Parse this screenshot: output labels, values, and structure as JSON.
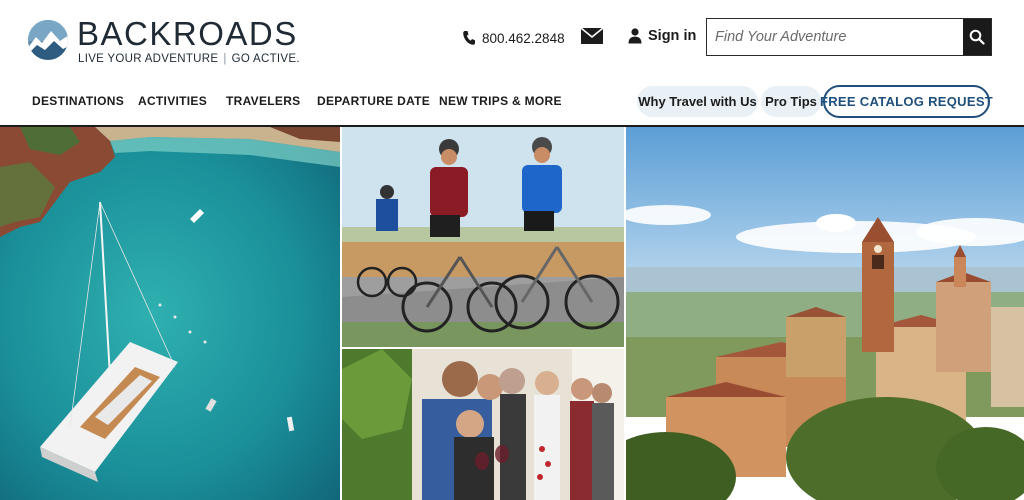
{
  "brand": {
    "name": "BACKROADS",
    "tagline_left": "LIVE YOUR ADVENTURE",
    "tagline_sep": "|",
    "tagline_right": "GO ACTIVE.",
    "logo_icon": "mountain-globe-icon",
    "colors": {
      "primary": "#1f2a35",
      "accent": "#1f4f7a",
      "pill_bg": "#e9f1f6"
    }
  },
  "header": {
    "phone": "800.462.2848",
    "phone_icon": "phone-icon",
    "mail_icon": "envelope-icon",
    "signin_label": "Sign in",
    "signin_icon": "user-icon",
    "search_placeholder": "Find Your Adventure",
    "search_icon": "search-icon"
  },
  "nav": {
    "items": [
      {
        "label": "DESTINATIONS"
      },
      {
        "label": "ACTIVITIES"
      },
      {
        "label": "TRAVELERS"
      },
      {
        "label": "DEPARTURE DATE"
      },
      {
        "label": "NEW TRIPS & MORE"
      }
    ],
    "pills": [
      {
        "label": "Why Travel with Us"
      },
      {
        "label": "Pro Tips"
      }
    ],
    "catalog_label": "FREE CATALOG REQUEST"
  },
  "hero": {
    "photos": [
      {
        "subject": "aerial view of catamaran in turquoise bay"
      },
      {
        "subject": "cyclists riding road bikes"
      },
      {
        "subject": "group of travelers toasting with wine"
      },
      {
        "subject": "hilltop italian village with bell tower"
      }
    ]
  }
}
